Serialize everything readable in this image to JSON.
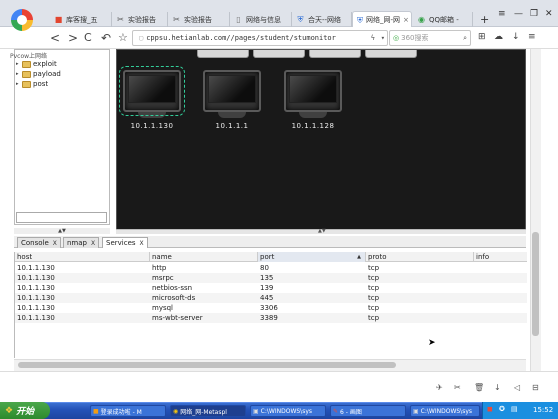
{
  "browser": {
    "tabs": [
      {
        "label": "库客搜_五"
      },
      {
        "label": "实验报告"
      },
      {
        "label": "实验报告"
      },
      {
        "label": "网络与信息"
      },
      {
        "label": "合天--网络"
      },
      {
        "label": "网络_网-网"
      },
      {
        "label": "QQ邮箱 -"
      }
    ],
    "new_tab": "+",
    "url": "cppsu.hetianlab.com//pages/student/stumonitor",
    "search_placeholder": "360搜索",
    "nav_back": "<",
    "nav_forward": ">",
    "nav_reload": "C",
    "nav_history": "↶",
    "nav_favorite": "☆"
  },
  "left_panel": {
    "breadcrumb": "Pvcow上网络",
    "tree": [
      {
        "label": "exploit"
      },
      {
        "label": "payload"
      },
      {
        "label": "post"
      }
    ]
  },
  "targets": [
    {
      "ip": "10.1.1.130"
    },
    {
      "ip": "10.1.1.1"
    },
    {
      "ip": "10.1.1.128"
    }
  ],
  "bottom_tabs": [
    {
      "label": "Console",
      "close": "X"
    },
    {
      "label": "nmap",
      "close": "X"
    },
    {
      "label": "Services",
      "close": "X"
    }
  ],
  "services": {
    "columns": [
      "host",
      "name",
      "port",
      "proto",
      "info"
    ],
    "rows": [
      {
        "host": "10.1.1.130",
        "name": "http",
        "port": "80",
        "proto": "tcp",
        "info": ""
      },
      {
        "host": "10.1.1.130",
        "name": "msrpc",
        "port": "135",
        "proto": "tcp",
        "info": ""
      },
      {
        "host": "10.1.1.130",
        "name": "netbios-ssn",
        "port": "139",
        "proto": "tcp",
        "info": ""
      },
      {
        "host": "10.1.1.130",
        "name": "microsoft-ds",
        "port": "445",
        "proto": "tcp",
        "info": ""
      },
      {
        "host": "10.1.1.130",
        "name": "mysql",
        "port": "3306",
        "proto": "tcp",
        "info": ""
      },
      {
        "host": "10.1.1.130",
        "name": "ms-wbt-server",
        "port": "3389",
        "proto": "tcp",
        "info": ""
      }
    ]
  },
  "taskbar": {
    "start": "开始",
    "tasks": [
      {
        "label": "登录成功啦 - M"
      },
      {
        "label": "网络_网-Metaspl"
      },
      {
        "label": "C:\\WINDOWS\\sys"
      },
      {
        "label": "6 - 画图"
      },
      {
        "label": "C:\\WINDOWS\\sys"
      }
    ],
    "clock": "15:52"
  },
  "colors": {
    "canvas": "#191919",
    "taskbar": "#2452b8",
    "start": "#2d8a2d",
    "folder": "#e7c15c"
  }
}
